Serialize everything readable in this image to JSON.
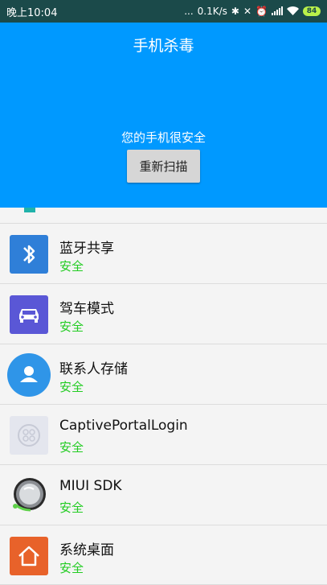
{
  "statusbar": {
    "time": "晚上10:04",
    "dots": "...",
    "speed": "0.1K/s",
    "battery": "84"
  },
  "header": {
    "title": "手机杀毒",
    "status_text": "您的手机很安全",
    "rescan_label": "重新扫描",
    "background_color": "#0099ff"
  },
  "apps": [
    {
      "name": "蓝牙共享",
      "status": "安全",
      "icon": "bluetooth-icon"
    },
    {
      "name": "驾车模式",
      "status": "安全",
      "icon": "car-icon"
    },
    {
      "name": "联系人存储",
      "status": "安全",
      "icon": "contact-person-icon"
    },
    {
      "name": "CaptivePortalLogin",
      "status": "安全",
      "icon": "android-default-icon"
    },
    {
      "name": "MIUI SDK",
      "status": "安全",
      "icon": "miui-sdk-icon"
    },
    {
      "name": "系统桌面",
      "status": "安全",
      "icon": "home-icon"
    }
  ],
  "colors": {
    "safe": "#22cc22",
    "statusbar": "#1b4a4a"
  }
}
